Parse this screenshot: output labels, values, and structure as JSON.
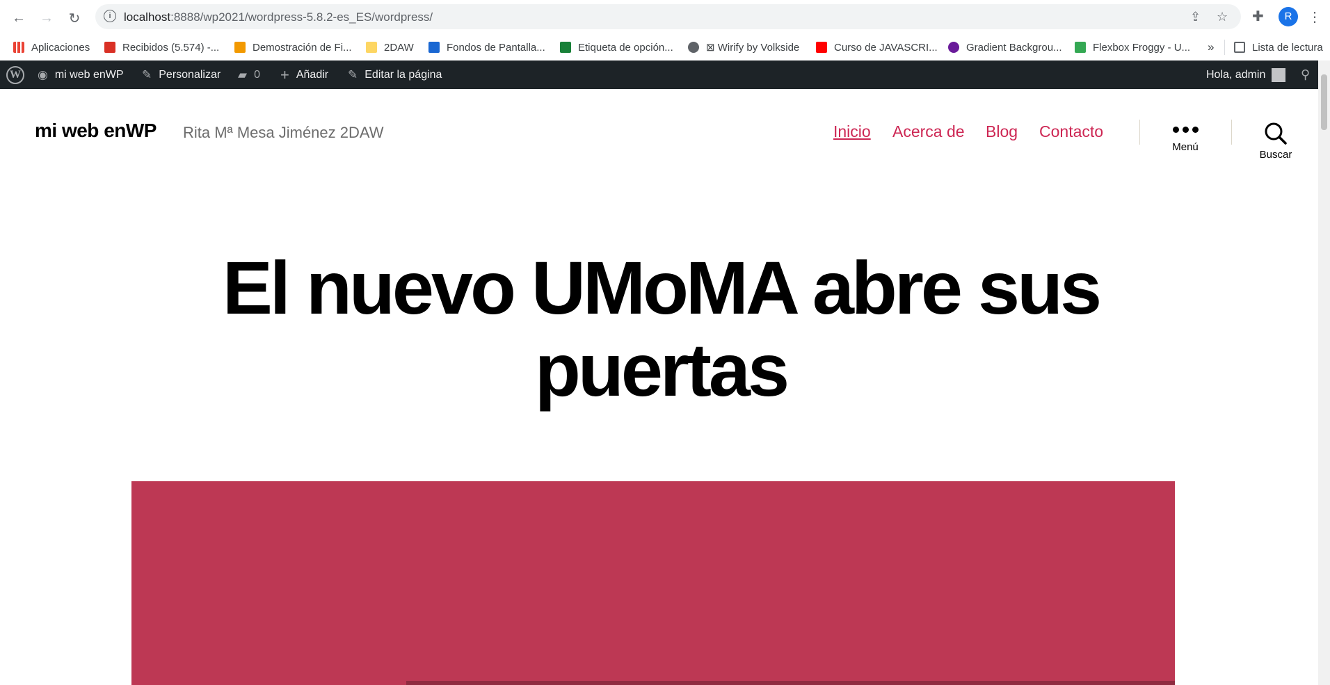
{
  "browser": {
    "url_host": "localhost",
    "url_rest": ":8888/wp2021/wordpress-5.8.2-es_ES/wordpress/",
    "profile_initial": "R",
    "icons": {
      "back": "arrow-left-icon",
      "forward": "arrow-right-icon",
      "reload": "reload-icon",
      "info": "info-icon",
      "share": "share-icon",
      "star": "star-icon",
      "extensions": "puzzle-icon",
      "menu": "kebab-menu-icon"
    }
  },
  "bookmarks": {
    "items": [
      {
        "label": "Aplicaciones",
        "color": "#ea4335"
      },
      {
        "label": "Recibidos (5.574) -...",
        "color": "#d93025"
      },
      {
        "label": "Demostración de Fi...",
        "color": "#f29900"
      },
      {
        "label": "2DAW",
        "color": "#fdd663"
      },
      {
        "label": "Fondos de Pantalla...",
        "color": "#1967d2"
      },
      {
        "label": "Etiqueta de opción...",
        "color": "#188038"
      },
      {
        "label": "⊠ Wirify by Volkside",
        "color": "#5f6368"
      },
      {
        "label": "Curso de JAVASCRI...",
        "color": "#ff0000"
      },
      {
        "label": "Gradient Backgrou...",
        "color": "#6a1b9a"
      },
      {
        "label": "Flexbox Froggy - U...",
        "color": "#34a853"
      }
    ],
    "overflow": "»",
    "reading_list": "Lista de lectura"
  },
  "adminbar": {
    "site_name": "mi web enWP",
    "customize": "Personalizar",
    "comments_count": "0",
    "new_label": "Añadir",
    "edit_label": "Editar la página",
    "greeting": "Hola, admin"
  },
  "site": {
    "title": "mi web enWP",
    "description": "Rita Mª Mesa Jiménez 2DAW",
    "nav": [
      "Inicio",
      "Acerca de",
      "Blog",
      "Contacto"
    ],
    "menu_label": "Menú",
    "search_label": "Buscar",
    "accent": "#cd2653"
  },
  "entry": {
    "title_line1": "El nuevo UMoMA abre sus",
    "title_line2": "puertas",
    "featured_color": "#bd3854"
  }
}
